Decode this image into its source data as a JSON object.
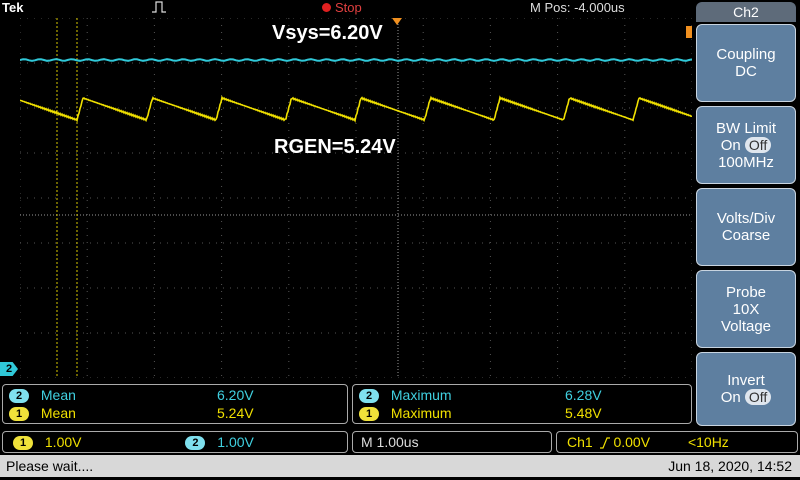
{
  "top": {
    "brand": "Tek",
    "state": "Stop",
    "mpos": "M Pos: -4.000us"
  },
  "annotations": {
    "vsys": "Vsys=6.20V",
    "rgen": "RGEN=5.24V"
  },
  "channel_markers": {
    "ch2": "2"
  },
  "side_menu": {
    "title": "Ch2",
    "coupling": {
      "label": "Coupling",
      "value": "DC"
    },
    "bw_limit": {
      "label": "BW Limit",
      "on": "On",
      "off": "Off",
      "freq": "100MHz"
    },
    "volts_div": {
      "label": "Volts/Div",
      "value": "Coarse"
    },
    "probe": {
      "label": "Probe",
      "atten": "10X",
      "type": "Voltage"
    },
    "invert": {
      "label": "Invert",
      "on": "On",
      "off": "Off"
    }
  },
  "measurements": {
    "left": {
      "row1": {
        "ch": "2",
        "name": "Mean",
        "value": "6.20V"
      },
      "row2": {
        "ch": "1",
        "name": "Mean",
        "value": "5.24V"
      }
    },
    "right": {
      "row1": {
        "ch": "2",
        "name": "Maximum",
        "value": "6.28V"
      },
      "row2": {
        "ch": "1",
        "name": "Maximum",
        "value": "5.48V"
      }
    }
  },
  "bottom": {
    "ch1_badge": "1",
    "ch1_scale": "1.00V",
    "ch2_badge": "2",
    "ch2_scale": "1.00V",
    "timebase": "M 1.00us",
    "trigger_src": "Ch1",
    "trigger_level": "0.00V",
    "trigger_freq": "<10Hz"
  },
  "status": {
    "message": "Please wait....",
    "datetime": "Jun 18, 2020, 14:52"
  },
  "colors": {
    "ch1": "#f0e000",
    "ch2": "#30c8d8",
    "grid": "#6a6a6a",
    "menu": "#5e7fa0"
  }
}
